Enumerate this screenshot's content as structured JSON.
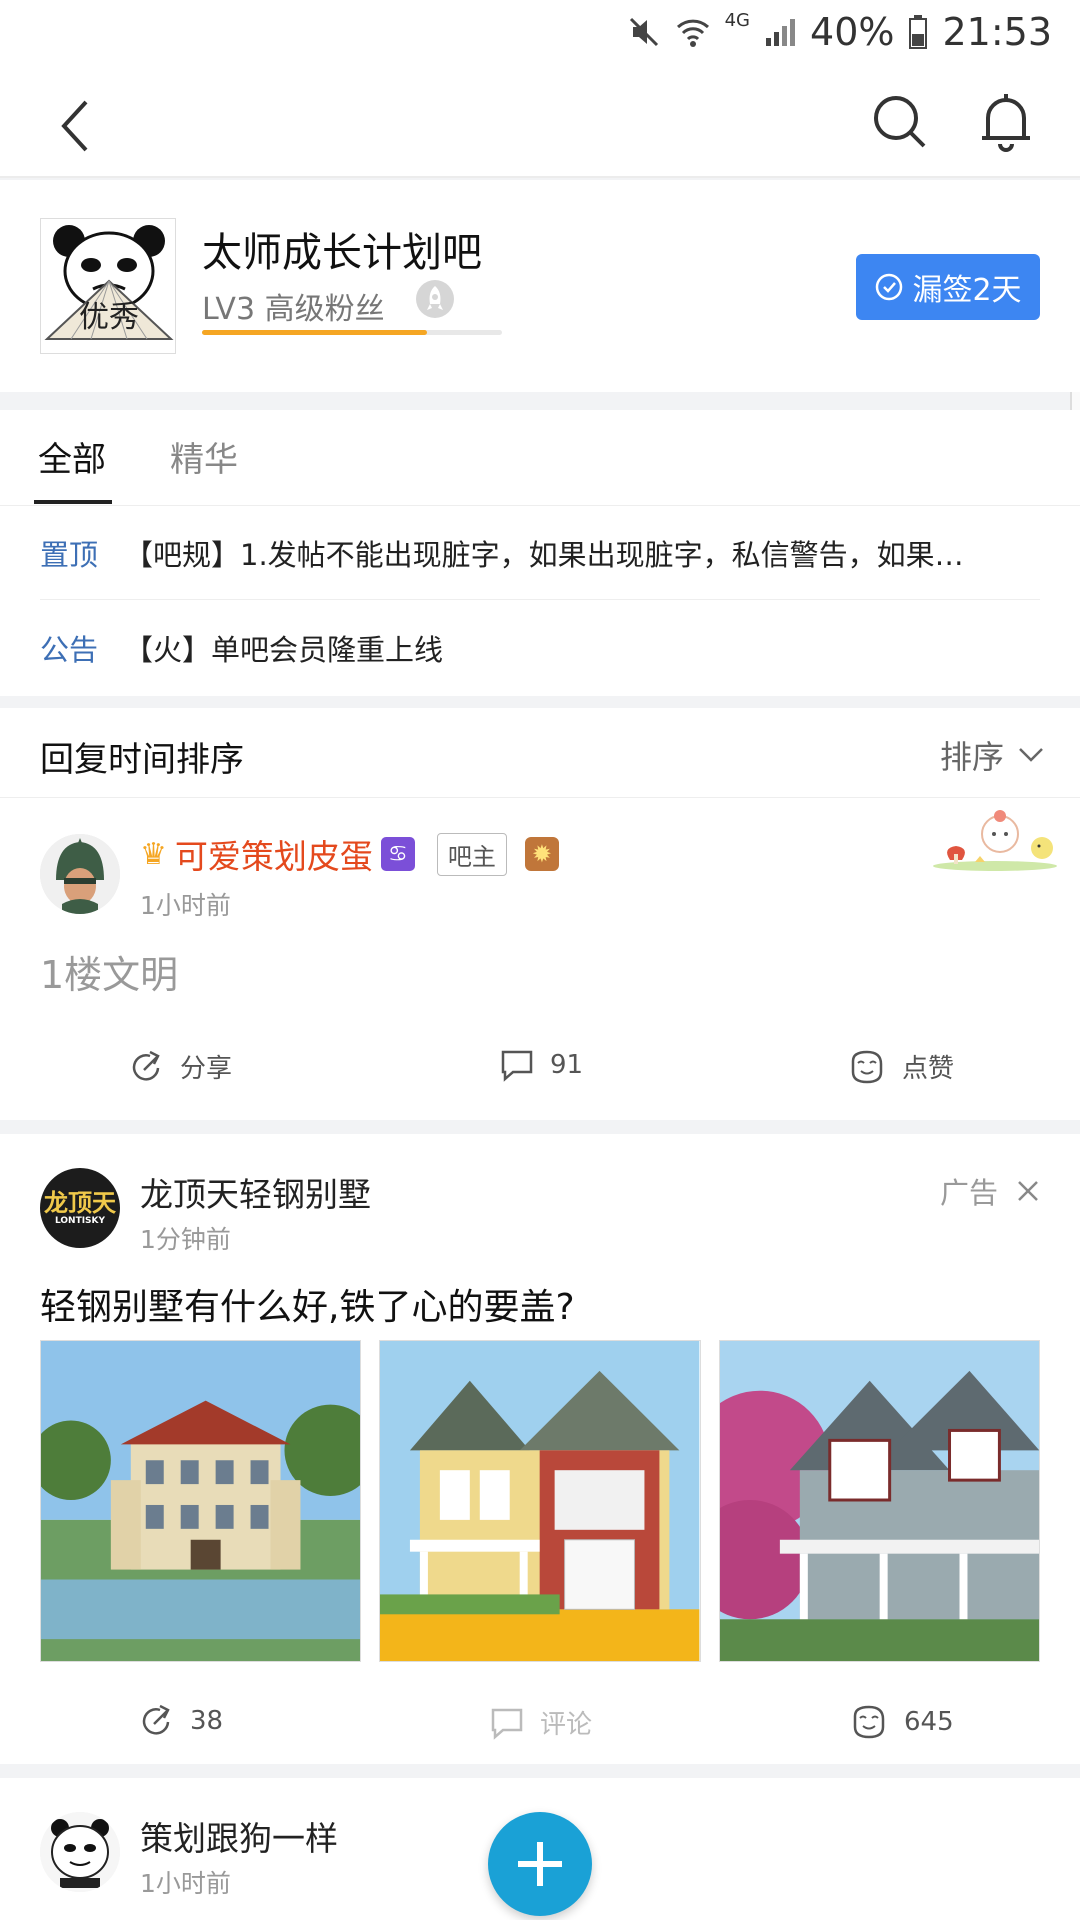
{
  "status_bar": {
    "network": "4G",
    "battery": "40%",
    "time": "21:53"
  },
  "forum": {
    "name": "太师成长计划吧",
    "level_text": "LV3  高级粉丝",
    "level_progress": 0.75,
    "checkin_label": "漏签2天",
    "avatar_text": "优秀"
  },
  "tabs": [
    {
      "label": "全部",
      "active": true
    },
    {
      "label": "精华",
      "active": false
    }
  ],
  "notices": [
    {
      "tag": "置顶",
      "text": "【吧规】1.发帖不能出现脏字，如果出现脏字，私信警告，如果…"
    },
    {
      "tag": "公告",
      "text": "【火】单吧会员隆重上线"
    }
  ],
  "sort": {
    "title": "回复时间排序",
    "button_label": "排序"
  },
  "post": {
    "author": "可爱策划皮蛋",
    "zodiac_symbol": "♋",
    "role": "吧主",
    "time": "1小时前",
    "body": "1楼文明",
    "share_label": "分享",
    "comment_count": "91",
    "like_label": "点赞"
  },
  "ad": {
    "logo_text": "龙顶天",
    "logo_sub": "LONTISKY",
    "name": "龙顶天轻钢别墅",
    "time": "1分钟前",
    "ad_label": "广告",
    "title": "轻钢别墅有什么好,铁了心的要盖?",
    "share_count": "38",
    "comment_label": "评论",
    "like_count": "645"
  },
  "next_post": {
    "author": "策划跟狗一样",
    "time": "1小时前"
  },
  "colors": {
    "accent_blue": "#3d86f2",
    "author_orange": "#e4491d",
    "fab_blue": "#1aa1d6",
    "notice_blue": "#3d6fb5"
  }
}
